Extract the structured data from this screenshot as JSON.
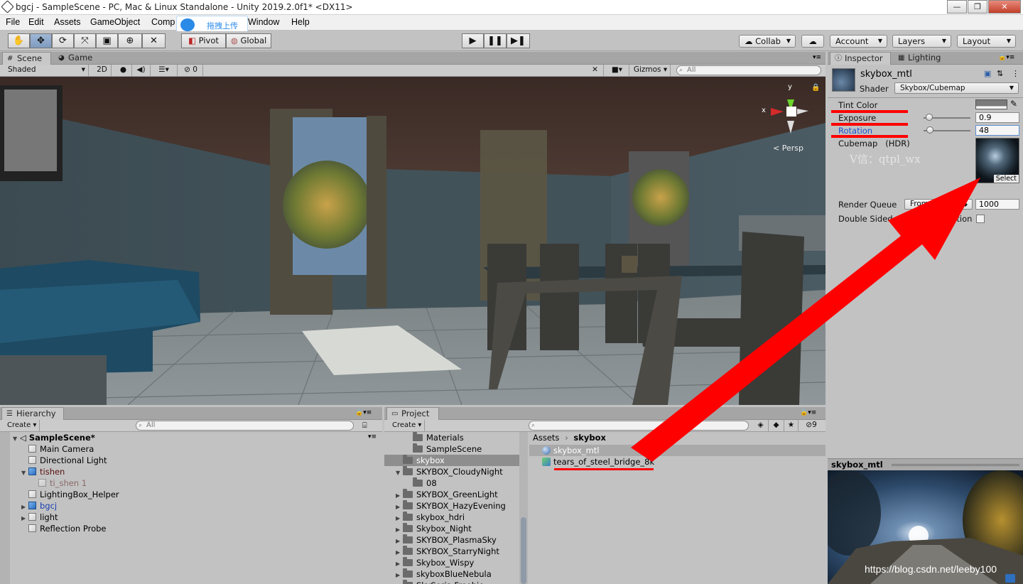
{
  "window": {
    "title": "bgcj - SampleScene - PC, Mac & Linux Standalone - Unity 2019.2.0f1* <DX11>",
    "min": "—",
    "max": "❐",
    "close": "✕"
  },
  "menu": [
    "File",
    "Edit",
    "Assets",
    "GameObject",
    "Comp",
    "Window",
    "Help"
  ],
  "upload_badge": "拖拽上传",
  "toolbar": {
    "pivot": "Pivot",
    "global": "Global",
    "collab": "Collab",
    "account": "Account",
    "layers": "Layers",
    "layout": "Layout"
  },
  "scene_tabs": {
    "scene": "Scene",
    "game": "Game"
  },
  "scene_bar": {
    "shading": "Shaded",
    "mode2d": "2D",
    "hidden_count": "0",
    "gizmos": "Gizmos",
    "search_placeholder": "All"
  },
  "scene_gizmo": {
    "y": "y",
    "x": "x",
    "persp": "Persp"
  },
  "hierarchy": {
    "tab": "Hierarchy",
    "create": "Create",
    "search_placeholder": "All",
    "scene": "SampleScene*",
    "items": [
      {
        "label": "Main Camera",
        "indent": 1,
        "icon": "white",
        "color": "#000",
        "arrow": ""
      },
      {
        "label": "Directional Light",
        "indent": 1,
        "icon": "white",
        "color": "#000",
        "arrow": ""
      },
      {
        "label": "tishen",
        "indent": 1,
        "icon": "blue",
        "color": "#5a1010",
        "arrow": "▼"
      },
      {
        "label": "ti_shen 1",
        "indent": 2,
        "icon": "grey",
        "color": "#8a6a6a",
        "arrow": ""
      },
      {
        "label": "LightingBox_Helper",
        "indent": 1,
        "icon": "white",
        "color": "#000",
        "arrow": ""
      },
      {
        "label": "bgcj",
        "indent": 1,
        "icon": "blue",
        "color": "#1a3fb0",
        "arrow": "▶"
      },
      {
        "label": "light",
        "indent": 1,
        "icon": "white",
        "color": "#000",
        "arrow": "▶"
      },
      {
        "label": "Reflection Probe",
        "indent": 1,
        "icon": "white",
        "color": "#000",
        "arrow": ""
      }
    ]
  },
  "project": {
    "tab": "Project",
    "create": "Create",
    "search_placeholder": "",
    "filter_count": "9",
    "tree": [
      {
        "label": "Materials",
        "indent": 2,
        "arrow": "",
        "sel": false
      },
      {
        "label": "SampleScene",
        "indent": 2,
        "arrow": "",
        "sel": false
      },
      {
        "label": "skybox",
        "indent": 1,
        "arrow": "",
        "sel": true
      },
      {
        "label": "SKYBOX_CloudyNight",
        "indent": 1,
        "arrow": "▼",
        "sel": false
      },
      {
        "label": "08",
        "indent": 2,
        "arrow": "",
        "sel": false
      },
      {
        "label": "SKYBOX_GreenLight",
        "indent": 1,
        "arrow": "▶",
        "sel": false
      },
      {
        "label": "SKYBOX_HazyEvening",
        "indent": 1,
        "arrow": "▶",
        "sel": false
      },
      {
        "label": "skybox_hdri",
        "indent": 1,
        "arrow": "▶",
        "sel": false
      },
      {
        "label": "Skybox_Night",
        "indent": 1,
        "arrow": "▶",
        "sel": false
      },
      {
        "label": "SKYBOX_PlasmaSky",
        "indent": 1,
        "arrow": "▶",
        "sel": false
      },
      {
        "label": "SKYBOX_StarryNight",
        "indent": 1,
        "arrow": "▶",
        "sel": false
      },
      {
        "label": "Skybox_Wispy",
        "indent": 1,
        "arrow": "▶",
        "sel": false
      },
      {
        "label": "skyboxBlueNebula",
        "indent": 1,
        "arrow": "▶",
        "sel": false
      },
      {
        "label": "SkySeria Freebie",
        "indent": 1,
        "arrow": "▶",
        "sel": false
      }
    ],
    "breadcrumb": {
      "root": "Assets",
      "sep": "›",
      "current": "skybox"
    },
    "assets": [
      {
        "label": "skybox_mtl",
        "sel": true
      },
      {
        "label": "tears_of_steel_bridge_8k",
        "sel": false
      }
    ]
  },
  "inspector": {
    "tab": "Inspector",
    "tab2": "Lighting",
    "material_name": "skybox_mtl",
    "shader_label": "Shader",
    "shader_value": "Skybox/Cubemap",
    "tint_label": "Tint Color",
    "exposure_label": "Exposure",
    "exposure_value": "0.9",
    "exposure_fraction": 0.12,
    "rotation_label": "Rotation",
    "rotation_value": "48",
    "rotation_fraction": 0.13,
    "cubemap_label": "Cubemap   (HDR)",
    "select": "Select",
    "watermark": "V信：qtpl_wx",
    "render_queue_label": "Render Queue",
    "render_queue_dd": "From Shader",
    "render_queue_value": "1000",
    "double_sided_label": "Double Sided Global Illumination"
  },
  "preview": {
    "title": "skybox_mtl"
  },
  "blog_watermark": "https://blog.csdn.net/leeby100"
}
